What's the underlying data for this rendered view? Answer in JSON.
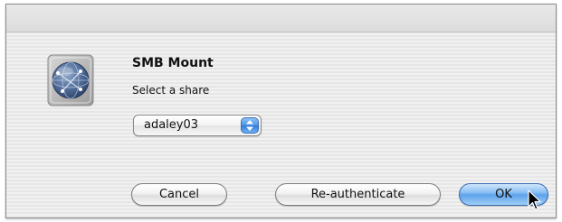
{
  "dialog": {
    "title": "SMB Mount",
    "message": "Select a share",
    "icon": "network-server-icon"
  },
  "share_select": {
    "selected": "adaley03",
    "icon": "popup-arrows-icon"
  },
  "buttons": {
    "cancel": "Cancel",
    "reauthenticate": "Re-authenticate",
    "ok": "OK"
  },
  "colors": {
    "default_button": "#5ea2ea",
    "popup_arrows": "#4d93e6"
  },
  "cursor": {
    "icon": "arrow-cursor-icon"
  }
}
